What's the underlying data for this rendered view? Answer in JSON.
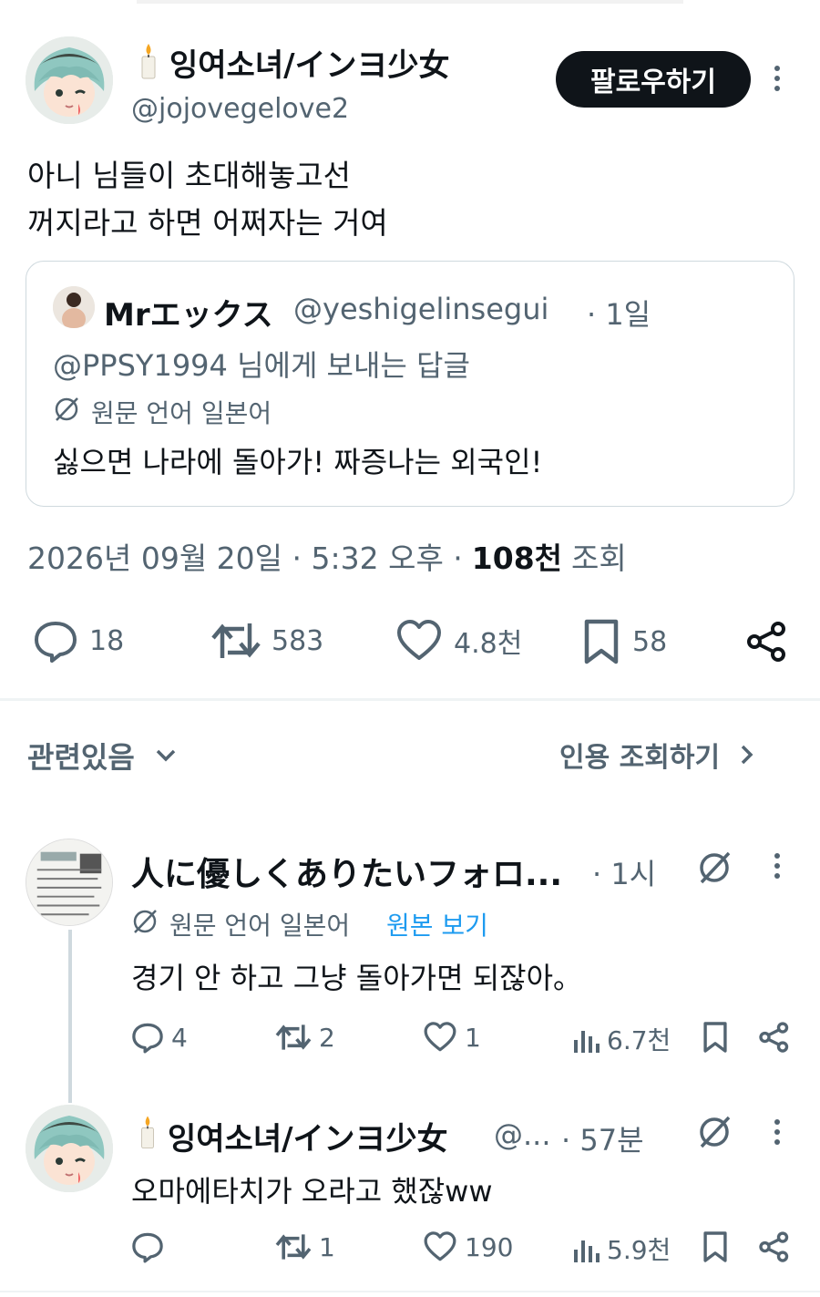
{
  "main_tweet": {
    "display_name": "잉여소녀/インヨ少女",
    "handle": "@jojovegelove2",
    "follow_label": "팔로우하기",
    "text_line1": "아니 님들이 초대해놓고선",
    "text_line2": "꺼지라고 하면 어쩌자는 거여",
    "quote": {
      "name": "Mrエックス",
      "handle": "@yeshigelinsegui",
      "time": "· 1일",
      "reply_to": "@PPSY1994 님에게 보내는 답글",
      "translate_note": "원문 언어 일본어",
      "text": "싫으면 나라에 돌아가! 짜증나는 외국인!"
    },
    "date": "2026년 09월 20일 · 5:32 오후 ·",
    "views_count": "108천",
    "views_label": "조회",
    "actions": {
      "replies": "18",
      "retweets": "583",
      "likes": "4.8천",
      "bookmarks": "58"
    }
  },
  "related": {
    "sort_label": "관련있음",
    "quotes_link": "인용 조회하기"
  },
  "replies": [
    {
      "name": "人に優しくありたいフォロ...",
      "time": "· 1시",
      "translate_note": "원문 언어 일본어",
      "show_original": "원본 보기",
      "text": "경기 안 하고 그냥 돌아가면 되잖아。",
      "replies": "4",
      "retweets": "2",
      "likes": "1",
      "views": "6.7천"
    },
    {
      "name": "잉여소녀/インヨ少女",
      "handle": "@...",
      "time": "· 57분",
      "text": "오마에타치가 오라고 했잖ww",
      "replies": "",
      "retweets": "1",
      "likes": "190",
      "views": "5.9천"
    }
  ],
  "colors": {
    "text": "#0f1419",
    "muted": "#536471",
    "link": "#1d9bf0",
    "border": "#cfd9de"
  }
}
